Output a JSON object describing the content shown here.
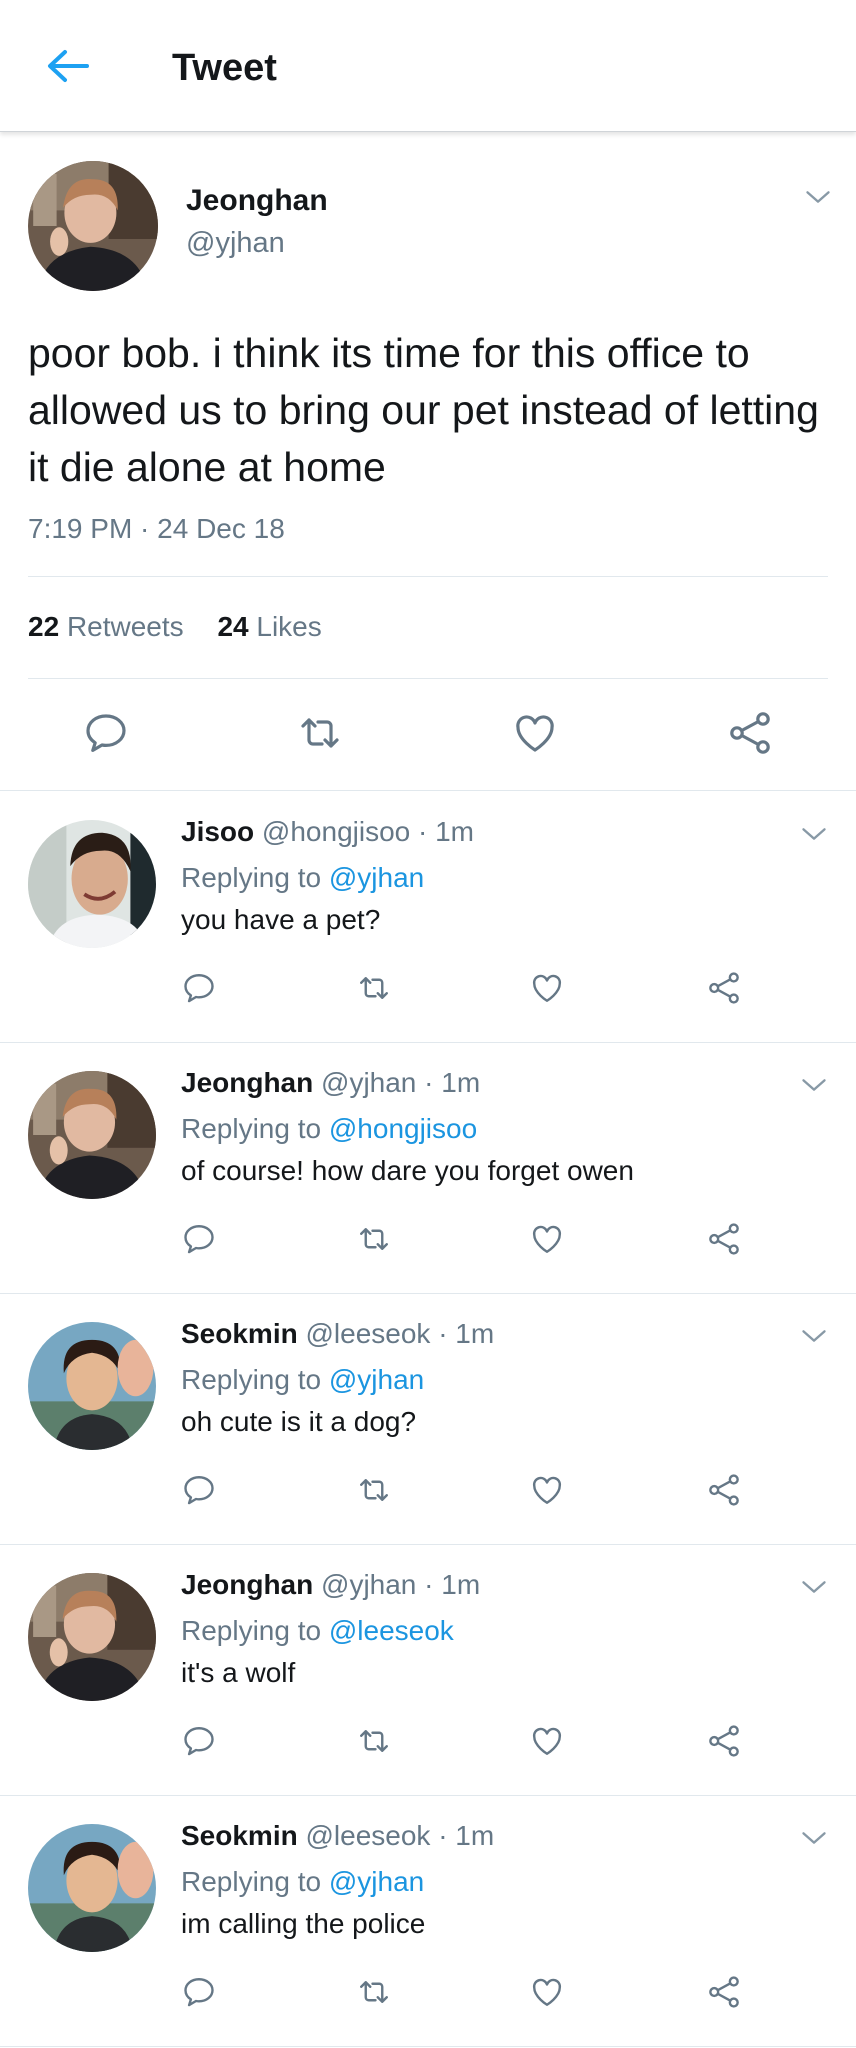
{
  "header": {
    "title": "Tweet",
    "back_icon": "arrow-left-icon"
  },
  "colors": {
    "accent": "#1da1f2",
    "link": "#1b95e0",
    "muted": "#657786",
    "text": "#14171a",
    "divider": "#e1e8ed"
  },
  "main_tweet": {
    "name": "Jeonghan",
    "handle": "@yjhan",
    "text": "poor bob. i think its time for this office to allowed us to bring our pet instead of letting it die alone at home",
    "timestamp": "7:19 PM · 24 Dec 18",
    "retweets_count": "22",
    "retweets_label": "Retweets",
    "likes_count": "24",
    "likes_label": "Likes"
  },
  "replies": [
    {
      "name": "Jisoo",
      "meta": "@hongjisoo · 1m",
      "replying_prefix": "Replying to ",
      "replying_to": "@yjhan",
      "text": "you have a pet?"
    },
    {
      "name": "Jeonghan",
      "meta": "@yjhan · 1m",
      "replying_prefix": "Replying to ",
      "replying_to": "@hongjisoo",
      "text": "of course! how dare you forget owen"
    },
    {
      "name": "Seokmin",
      "meta": "@leeseok · 1m",
      "replying_prefix": "Replying to ",
      "replying_to": "@yjhan",
      "text": "oh cute is it a dog?"
    },
    {
      "name": "Jeonghan",
      "meta": "@yjhan · 1m",
      "replying_prefix": "Replying to ",
      "replying_to": "@leeseok",
      "text": "it's a wolf"
    },
    {
      "name": "Seokmin",
      "meta": "@leeseok · 1m",
      "replying_prefix": "Replying to ",
      "replying_to": "@yjhan",
      "text": "im calling the police"
    }
  ]
}
